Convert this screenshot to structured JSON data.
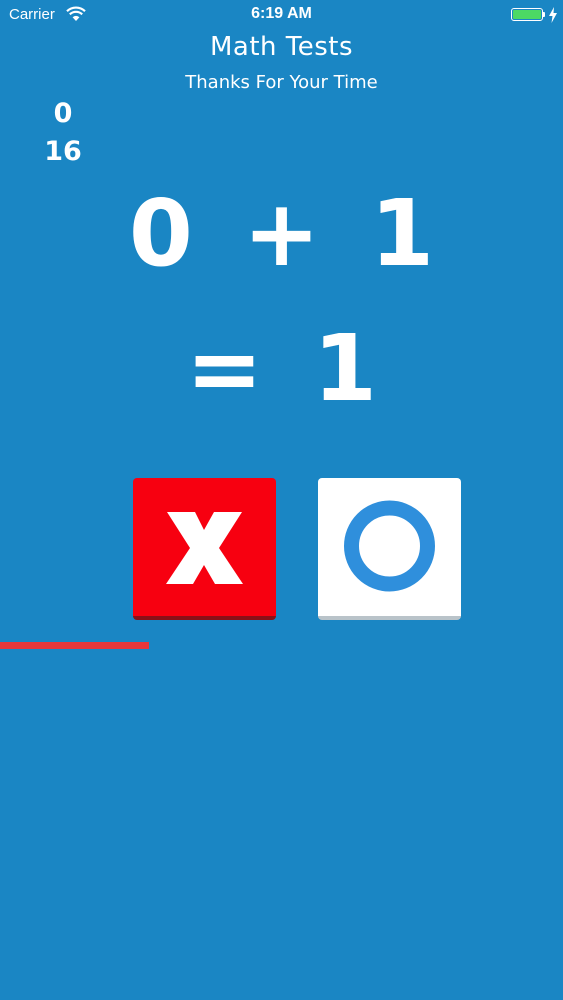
{
  "status_bar": {
    "carrier": "Carrier",
    "time": "6:19 AM",
    "battery_color": "#4cd964"
  },
  "header": {
    "title": "Math Tests",
    "subtitle": "Thanks For Your Time"
  },
  "score": {
    "current": "0",
    "total": "16"
  },
  "question": {
    "expression": "0 + 1",
    "result": "= 1"
  },
  "answers": {
    "wrong": {
      "icon": "x-icon",
      "color": "#f70010"
    },
    "right": {
      "icon": "circle-icon",
      "color": "#2f8fdc"
    }
  },
  "timer": {
    "progress": 0.265,
    "color": "#e8373a"
  },
  "theme": {
    "background": "#1a86c4"
  }
}
